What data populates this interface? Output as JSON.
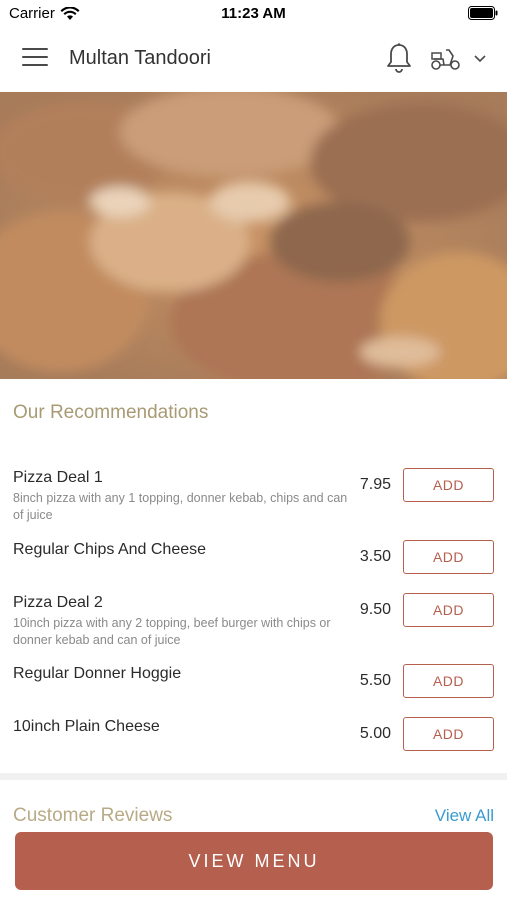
{
  "status_bar": {
    "carrier": "Carrier",
    "time": "11:23 AM",
    "icons": [
      "wifi-icon",
      "battery-icon"
    ]
  },
  "header": {
    "title": "Multan Tandoori",
    "icons": [
      "menu-icon",
      "bell-icon",
      "scooter-icon",
      "chevron-down-icon"
    ]
  },
  "hero": {
    "image": "food-photo"
  },
  "recommendations": {
    "title": "Our Recommendations",
    "add_label": "ADD",
    "items": [
      {
        "name": "Pizza Deal 1",
        "description": "8inch pizza with any 1 topping, donner kebab, chips and can of juice",
        "price": "7.95"
      },
      {
        "name": "Regular Chips And Cheese",
        "description": "",
        "price": "3.50"
      },
      {
        "name": "Pizza Deal 2",
        "description": "10inch pizza with any 2 topping, beef burger with chips or donner kebab  and can of juice",
        "price": "9.50"
      },
      {
        "name": "Regular Donner Hoggie",
        "description": "",
        "price": "5.50"
      },
      {
        "name": "10inch Plain Cheese",
        "description": "",
        "price": "5.00"
      }
    ]
  },
  "reviews": {
    "title": "Customer Reviews",
    "view_all": "View All"
  },
  "footer": {
    "view_menu": "VIEW MENU"
  },
  "colors": {
    "accent": "#b5604f",
    "section_title": "#a89a74",
    "link": "#3a9bd0"
  }
}
